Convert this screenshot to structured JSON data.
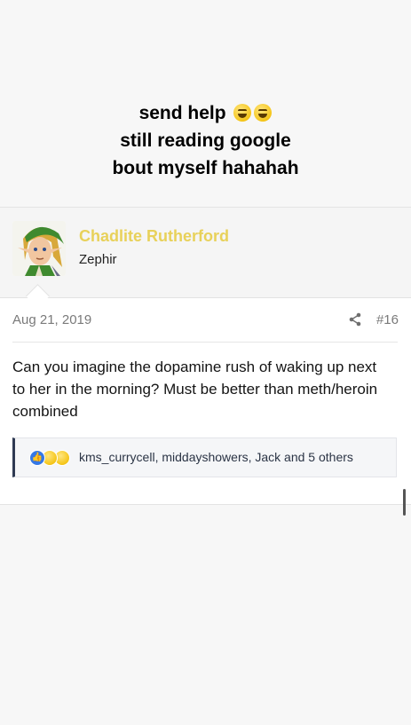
{
  "caption": {
    "line1": "send help",
    "line2": "still reading google",
    "line3": "bout myself hahahah",
    "emoji_icons": [
      "grinning-squinting-face-icon",
      "grinning-squinting-face-icon"
    ]
  },
  "post": {
    "author": {
      "name": "Chadlite Rutherford",
      "title": "Zephir",
      "name_color": "#e8d15a"
    },
    "date": "Aug 21, 2019",
    "share_icon": "share-icon",
    "number": "#16",
    "body": "Can you imagine the dopamine rush of waking up next to her in the morning? Must be better than meth/heroin combined",
    "reactions": {
      "icons": [
        "like-icon",
        "laugh-icon",
        "sad-icon"
      ],
      "users_text": "kms_currycell, middayshowers, Jack and 5 others"
    }
  }
}
